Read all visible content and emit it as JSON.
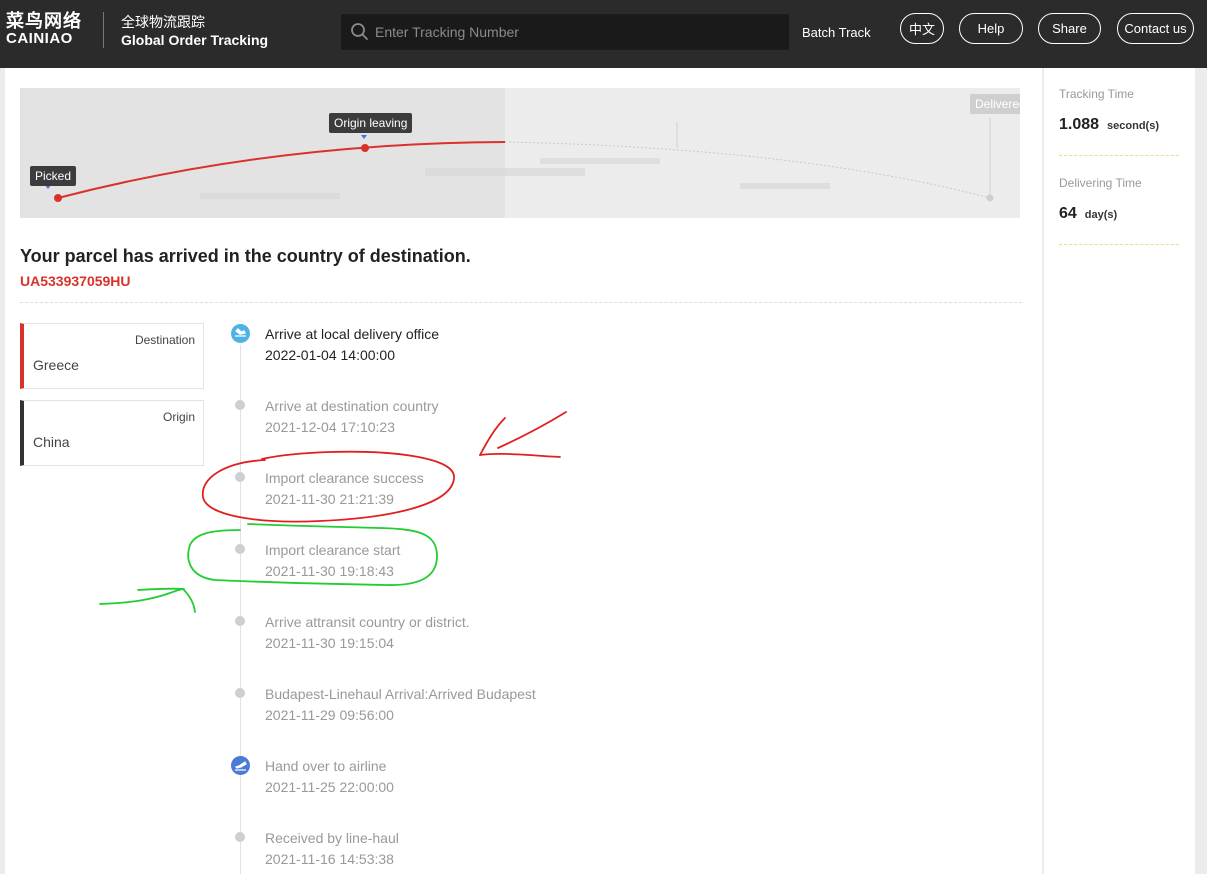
{
  "header": {
    "logo_cn": "菜鸟网络",
    "logo_en": "CAINIAO",
    "subtitle_cn": "全球物流跟踪",
    "subtitle_en": "Global Order Tracking",
    "search_placeholder": "Enter Tracking Number",
    "batch_track": "Batch Track",
    "lang_button": "中文",
    "help_button": "Help",
    "share_button": "Share",
    "contact_button": "Contact us"
  },
  "progress_map": {
    "picked_label": "Picked",
    "origin_leaving_label": "Origin leaving",
    "delivered_label": "Delivered"
  },
  "status": {
    "title": "Your parcel has arrived in the country of destination.",
    "tracking_number": "UA533937059HU"
  },
  "locations": {
    "destination_label": "Destination",
    "destination_value": "Greece",
    "origin_label": "Origin",
    "origin_value": "China"
  },
  "events": [
    {
      "title": "Arrive at local delivery office",
      "time": "2022-01-04 14:00:00",
      "icon": "plane-arrival-icon"
    },
    {
      "title": "Arrive at destination country",
      "time": "2021-12-04 17:10:23"
    },
    {
      "title": "Import clearance success",
      "time": "2021-11-30 21:21:39"
    },
    {
      "title": "Import clearance start",
      "time": "2021-11-30 19:18:43"
    },
    {
      "title": "Arrive attransit country or district.",
      "time": "2021-11-30 19:15:04"
    },
    {
      "title": "Budapest-Linehaul Arrival:Arrived Budapest",
      "time": "2021-11-29 09:56:00"
    },
    {
      "title": "Hand over to airline",
      "time": "2021-11-25 22:00:00",
      "icon": "plane-departure-icon"
    },
    {
      "title": "Received by line-haul",
      "time": "2021-11-16 14:53:38"
    }
  ],
  "sidebar": {
    "tracking_time_label": "Tracking Time",
    "tracking_time_value": "1.088",
    "tracking_time_unit": "second(s)",
    "delivering_time_label": "Delivering Time",
    "delivering_time_value": "64",
    "delivering_time_unit": "day(s)"
  },
  "colors": {
    "accent_red": "#d9322b",
    "header_bg": "#2b2b2b",
    "icon_blue_light": "#4db3e6",
    "icon_blue": "#4a7bd8",
    "annotation_red": "#e02020",
    "annotation_green": "#22cc33"
  }
}
